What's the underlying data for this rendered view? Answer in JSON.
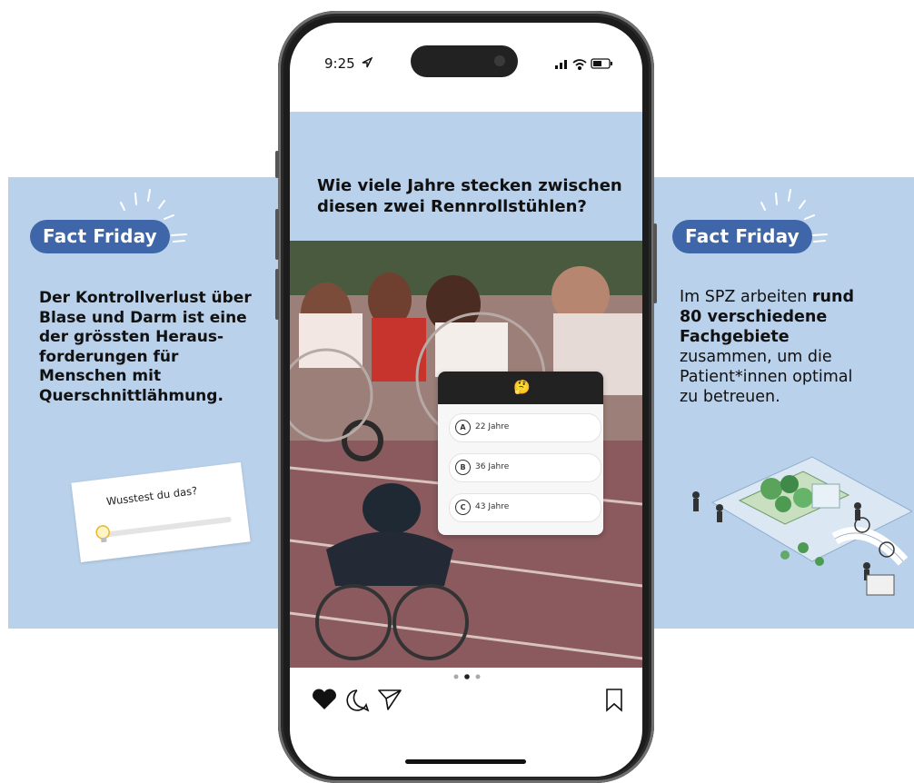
{
  "left_card": {
    "badge": "Fact Friday",
    "text": "Der Kontrollverlust über Blase und Darm ist eine der grössten Heraus-forderungen für Menschen mit Querschnittlähmung.",
    "text_lines": [
      "Der Kontrollverlust über",
      "Blase und Darm ist eine",
      "der grössten Heraus-",
      "forderungen für",
      "Menschen mit",
      "Querschnittlähmung."
    ],
    "poll": {
      "question": "Wusstest du das?",
      "slider_icon": "lightbulb-icon"
    }
  },
  "right_card": {
    "badge": "Fact Friday",
    "text_lines": [
      {
        "normal": "Im SPZ arbeiten ",
        "bold": "rund"
      },
      {
        "normal": "",
        "bold": "80 verschiedene"
      },
      {
        "normal": "",
        "bold": "Fachgebiete"
      },
      {
        "normal": "zusammen, um die",
        "bold": ""
      },
      {
        "normal": "Patient*innen optimal",
        "bold": ""
      },
      {
        "normal": "zu betreuen.",
        "bold": ""
      }
    ]
  },
  "phone": {
    "status": {
      "time": "9:25",
      "icons": [
        "location-arrow-icon",
        "signal-icon",
        "wifi-icon",
        "battery-icon"
      ]
    },
    "post": {
      "question": "Wie viele Jahre stecken zwischen diesen zwei Rennrollstühlen?",
      "question_lines": [
        "Wie viele Jahre stecken zwischen",
        "diesen zwei Rennrollstühlen?"
      ],
      "quiz": {
        "emoji": "🤔",
        "options": [
          {
            "letter": "A",
            "label": "22 Jahre"
          },
          {
            "letter": "B",
            "label": "36 Jahre"
          },
          {
            "letter": "C",
            "label": "43 Jahre"
          }
        ]
      },
      "carousel": {
        "count": 3,
        "active": 2
      },
      "actions": [
        "heart-icon",
        "comment-icon",
        "share-icon",
        "bookmark-icon"
      ]
    }
  },
  "colors": {
    "card_bg": "#b9d1ea",
    "badge_bg": "#3f66a8",
    "track_red": "#8a5a5e"
  }
}
